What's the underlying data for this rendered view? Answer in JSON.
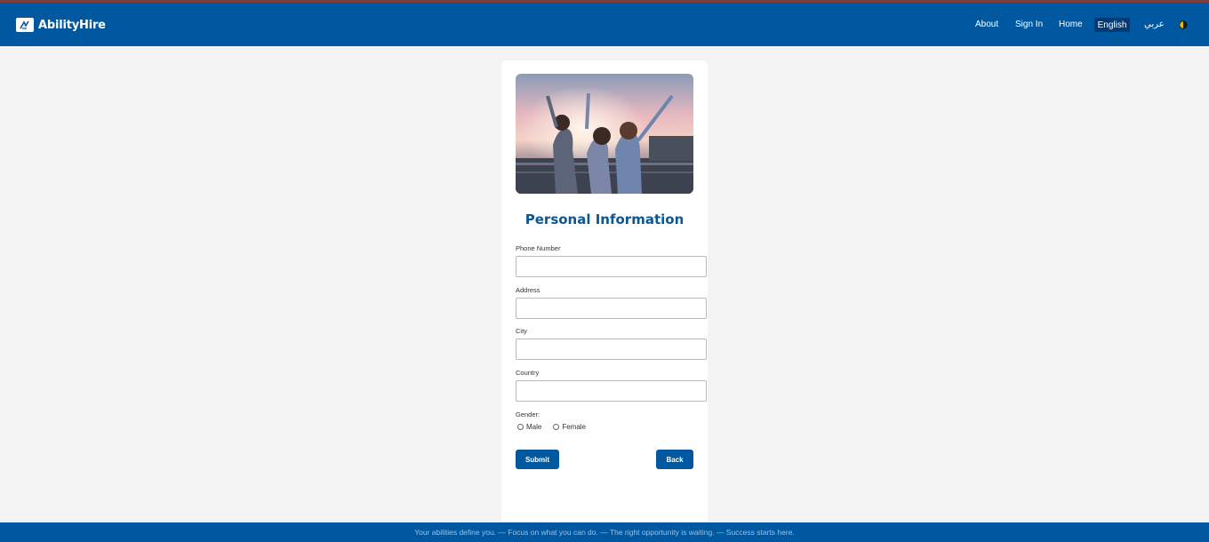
{
  "navbar": {
    "brand": "AbilityHire",
    "links": {
      "about": "About",
      "sign_in": "Sign In",
      "home": "Home",
      "english": "English",
      "arabic": "عربي"
    },
    "colors": {
      "bar": "#0058a0",
      "active_lang": "#063a74"
    }
  },
  "form": {
    "title": "Personal Information",
    "fields": {
      "phone": {
        "label": "Phone Number",
        "value": ""
      },
      "address": {
        "label": "Address",
        "value": ""
      },
      "city": {
        "label": "City",
        "value": ""
      },
      "country": {
        "label": "Country",
        "value": ""
      }
    },
    "gender": {
      "label": "Gender:",
      "options": [
        "Male",
        "Female"
      ]
    },
    "submit": "Submit",
    "back": "Back"
  },
  "footer": {
    "ticker": "Your abilities define you. — Focus on what you can do. — The right opportunity is waiting. — Success starts here."
  }
}
